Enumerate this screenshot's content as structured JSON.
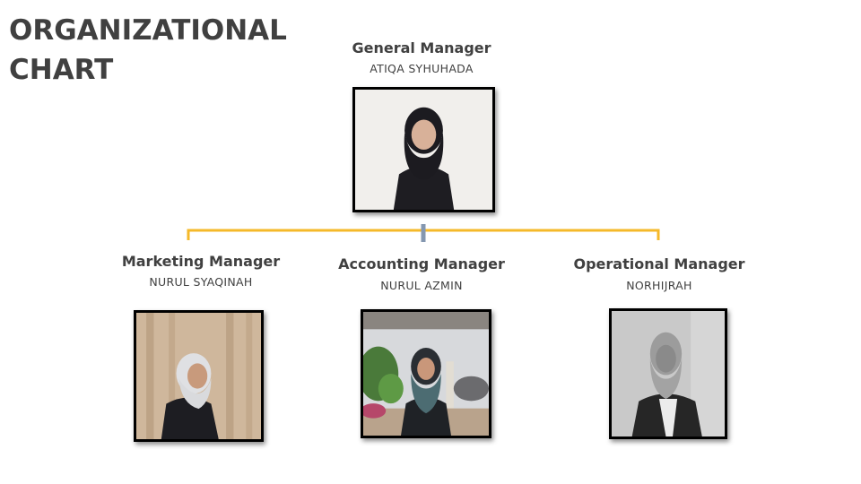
{
  "title": {
    "line1": "ORGANIZATIONAL",
    "line2": "CHART"
  },
  "colors": {
    "connector": "#F5B92A",
    "stem": "#8497B0",
    "text": "#404040",
    "frame": "#000000"
  },
  "nodes": {
    "general": {
      "role": "General Manager",
      "name": "ATIQA SYHUHADA",
      "photo": "portrait-photo"
    },
    "marketing": {
      "role": "Marketing Manager",
      "name": "NURUL SYAQINAH",
      "photo": "portrait-photo"
    },
    "accounting": {
      "role": "Accounting Manager",
      "name": "NURUL AZMIN",
      "photo": "portrait-photo"
    },
    "operational": {
      "role": "Operational Manager",
      "name": "NORHIJRAH",
      "photo": "portrait-photo"
    }
  }
}
